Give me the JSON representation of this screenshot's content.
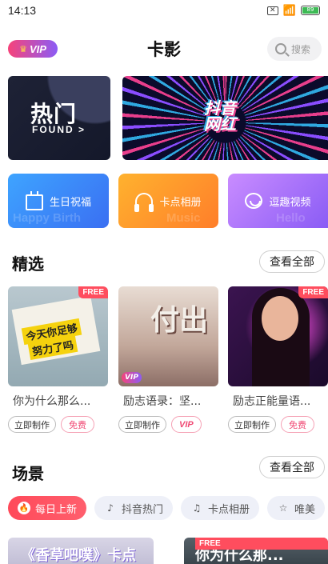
{
  "status_bar": {
    "time": "14:13",
    "battery": "89"
  },
  "header": {
    "vip_label": "VIP",
    "title": "卡影",
    "search_placeholder": "搜索"
  },
  "banners": [
    {
      "text_main": "热门",
      "text_sub": "FOUND >"
    },
    {
      "text_logo_line1": "抖音",
      "text_logo_line2": "网红"
    }
  ],
  "quick_actions": [
    {
      "label": "生日祝福",
      "ghost": "Happy Birth",
      "icon": "calendar-icon"
    },
    {
      "label": "卡点相册",
      "ghost": "Music",
      "icon": "headphones-icon"
    },
    {
      "label": "逗趣视频",
      "ghost": "Hello",
      "icon": "smile-icon"
    }
  ],
  "featured": {
    "title": "精选",
    "view_all": "查看全部",
    "cards": [
      {
        "title": "你为什么那么...",
        "make": "立即制作",
        "tag": "免费",
        "badge": "FREE",
        "overlay1": "今天你足够",
        "overlay2": "努力了吗"
      },
      {
        "title": "励志语录：坚...",
        "make": "立即制作",
        "tag": "VIP",
        "badge": "",
        "overlay1": "付出",
        "vip_mini": "VIP"
      },
      {
        "title": "励志正能量语...",
        "make": "立即制作",
        "tag": "免费",
        "badge": "FREE"
      }
    ]
  },
  "scenes": {
    "title": "场景",
    "view_all": "查看全部",
    "chips": [
      {
        "label": "每日上新",
        "icon": "flame-icon",
        "active": true
      },
      {
        "label": "抖音热门",
        "icon": "tiktok-icon",
        "active": false
      },
      {
        "label": "卡点相册",
        "icon": "music-note-icon",
        "active": false
      },
      {
        "label": "唯美",
        "icon": "star-icon",
        "active": false
      }
    ],
    "preview_cards": [
      {
        "text": "《香草吧噗》卡点"
      },
      {
        "text": "你为什么那...",
        "badge": "FREE"
      }
    ]
  }
}
